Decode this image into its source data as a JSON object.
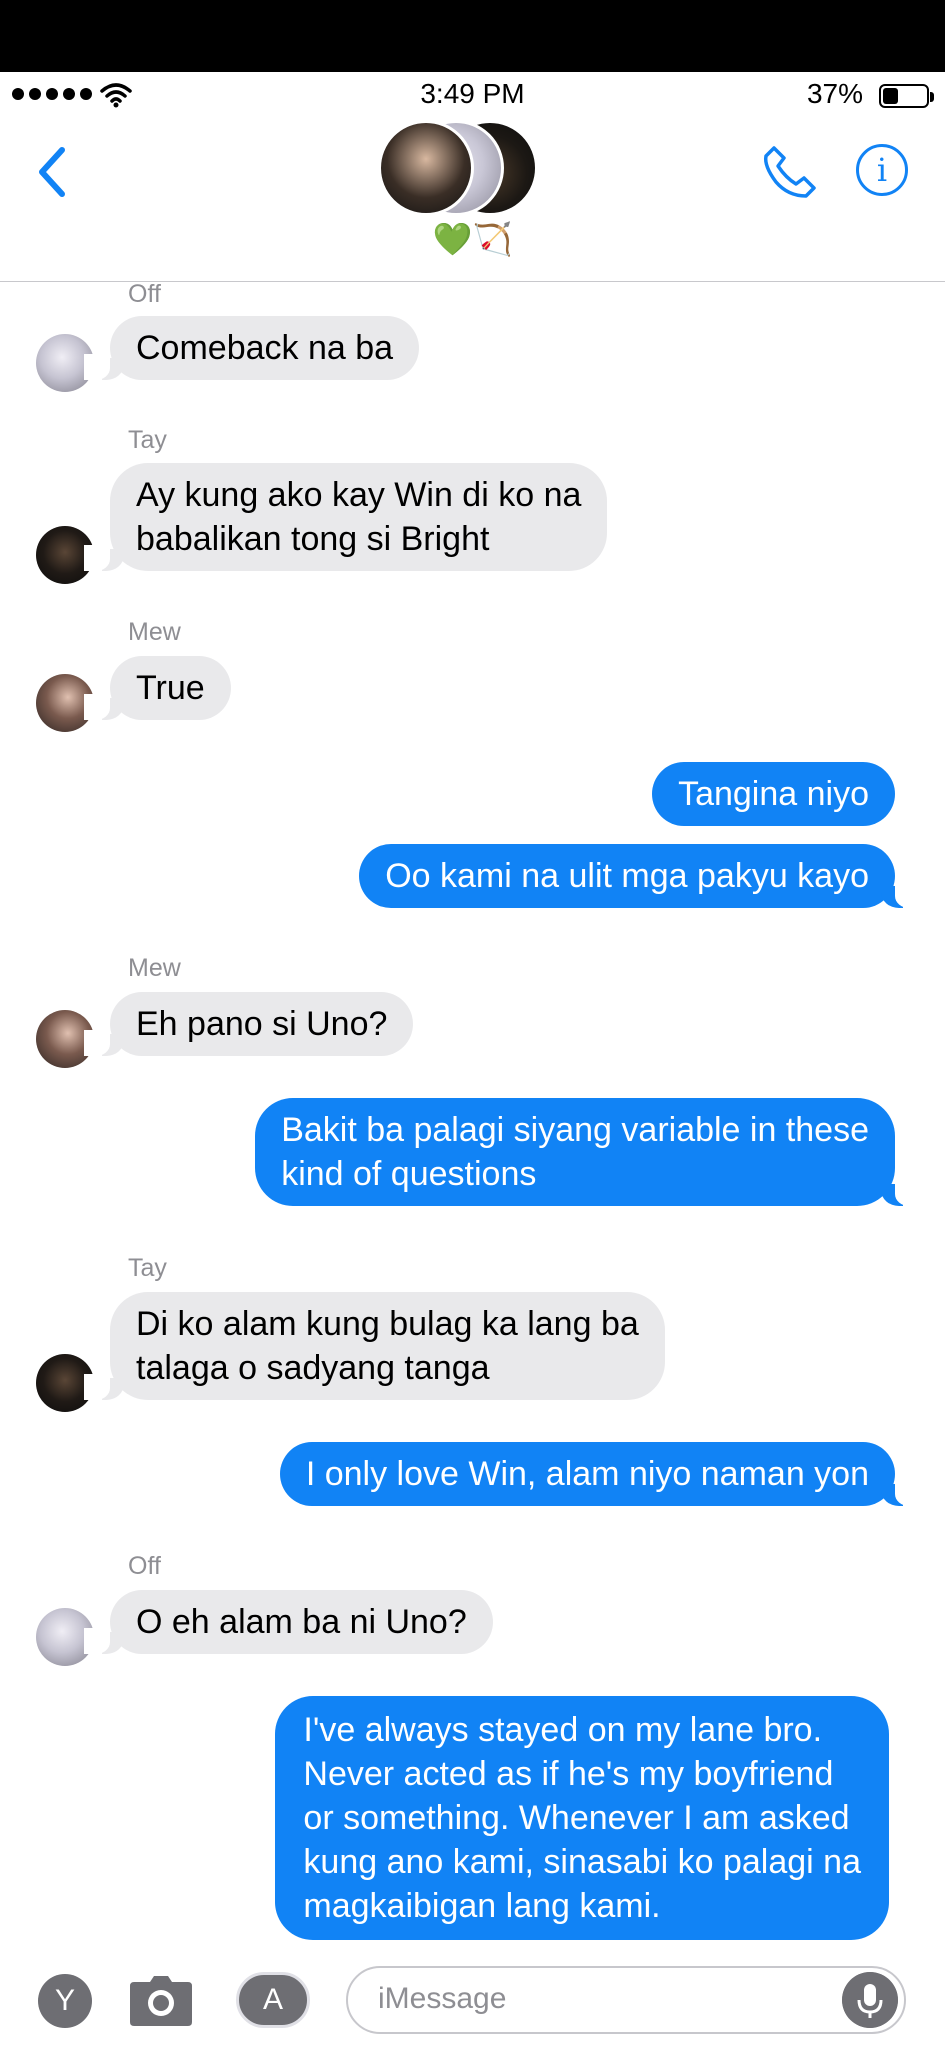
{
  "status_bar": {
    "time": "3:49 PM",
    "battery": "37%"
  },
  "header": {
    "group_name": "💚🏹"
  },
  "messages": [
    {
      "sender": "Off",
      "text": [
        "Comeback na ba"
      ]
    },
    {
      "sender": "Tay",
      "text": [
        "Ay kung ako kay Win di ko na",
        "babalikan tong si Bright"
      ]
    },
    {
      "sender": "Mew",
      "text": [
        "True"
      ]
    },
    {
      "sender": "",
      "text": [
        "Tangina niyo"
      ]
    },
    {
      "sender": "",
      "text": [
        "Oo kami na ulit mga pakyu kayo"
      ]
    },
    {
      "sender": "Mew",
      "text": [
        "Eh pano si Uno?"
      ]
    },
    {
      "sender": "",
      "text": [
        "Bakit ba palagi siyang variable in these",
        "kind of questions"
      ]
    },
    {
      "sender": "Tay",
      "text": [
        "Di ko alam kung bulag ka lang ba",
        "talaga o sadyang tanga"
      ]
    },
    {
      "sender": "",
      "text": [
        "I only love Win, alam niyo naman yon"
      ]
    },
    {
      "sender": "Off",
      "text": [
        "O eh alam ba ni Uno?"
      ]
    },
    {
      "sender": "",
      "text": [
        "I've always stayed on my lane bro.",
        "Never acted as if he's my boyfriend",
        "or something. Whenever I am asked",
        "kung ano kami, sinasabi ko palagi na",
        "magkaibigan lang kami."
      ]
    }
  ],
  "input_bar": {
    "placeholder": "iMessage",
    "app_label": "Y"
  },
  "colors": {
    "outgoing": "#1183f5",
    "incoming": "#e9e9eb",
    "accent": "#1183f5"
  },
  "icons": [
    "back-chevron-icon",
    "phone-icon",
    "info-icon",
    "camera-icon",
    "app-store-icon",
    "microphone-icon",
    "wifi-icon"
  ]
}
